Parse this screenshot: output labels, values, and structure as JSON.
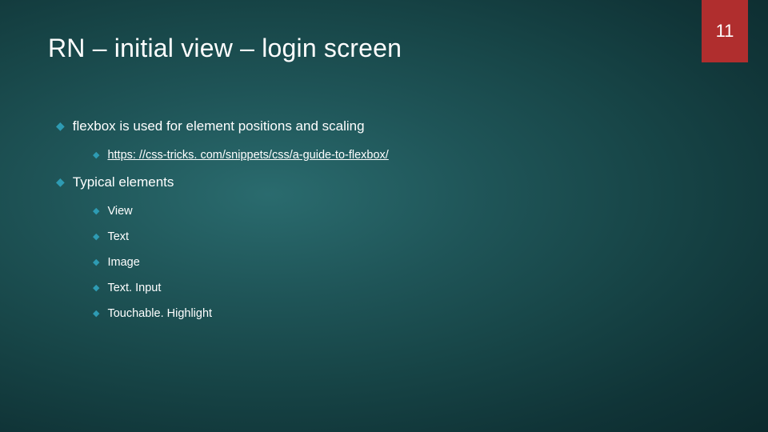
{
  "page_number": "11",
  "title": "RN – initial view – login screen",
  "bullets": {
    "flexbox": "flexbox is used for element positions and scaling",
    "flexbox_link": "https: //css-tricks. com/snippets/css/a-guide-to-flexbox/",
    "typical": "Typical elements",
    "typical_items": {
      "view": "View",
      "text": "Text",
      "image": "Image",
      "textinput": "Text. Input",
      "touchable": "Touchable. Highlight"
    }
  }
}
